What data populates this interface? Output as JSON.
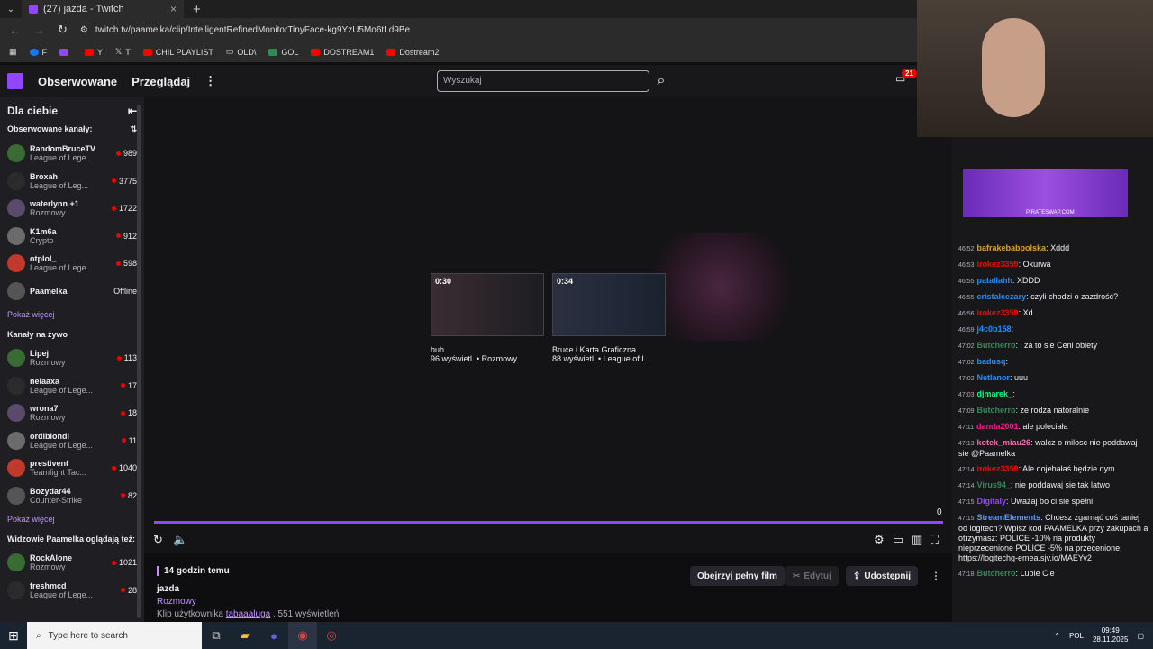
{
  "browser": {
    "tab_title": "(27) jazda - Twitch",
    "url": "twitch.tv/paamelka/clip/IntelligentRefinedMonitorTinyFace-kg9YzU5Mo6tLd9Be",
    "bookmarks": [
      "F",
      "",
      "Y",
      "T",
      "CHIL PLAYLIST",
      "OLD\\",
      "GOL",
      "DOSTREAM1",
      "Dostream2"
    ]
  },
  "nav": {
    "following": "Obserwowane",
    "browse": "Przeglądaj",
    "search_placeholder": "Wyszukaj",
    "notif_count": "21"
  },
  "sidebar": {
    "title": "Dla ciebie",
    "followed_label": "Obserwowane kanały:",
    "followed": [
      {
        "name": "RandomBruceTV",
        "game": "League of Lege...",
        "viewers": "989"
      },
      {
        "name": "Broxah",
        "game": "League of Leg...",
        "viewers": "3775"
      },
      {
        "name": "waterlynn +1",
        "game": "Rozmowy",
        "viewers": "1722"
      },
      {
        "name": "K1m6a",
        "game": "Crypto",
        "viewers": "912"
      },
      {
        "name": "otplol_",
        "game": "League of Lege...",
        "viewers": "598"
      },
      {
        "name": "Paamelka",
        "game": "",
        "viewers": "Offline"
      }
    ],
    "show_more": "Pokaż więcej",
    "live_label": "Kanały na żywo",
    "live": [
      {
        "name": "Lipej",
        "game": "Rozmowy",
        "viewers": "113"
      },
      {
        "name": "nelaaxa",
        "game": "League of Lege...",
        "viewers": "17"
      },
      {
        "name": "wrona7",
        "game": "Rozmowy",
        "viewers": "18"
      },
      {
        "name": "ordiblondi",
        "game": "League of Lege...",
        "viewers": "11"
      },
      {
        "name": "prestivent",
        "game": "Teamfight Tac...",
        "viewers": "1040"
      },
      {
        "name": "Bozydar44",
        "game": "Counter-Strike",
        "viewers": "82"
      }
    ],
    "show_more2": "Pokaż więcej",
    "viewers_also_label": "Widzowie Paamelka oglądają też:",
    "also": [
      {
        "name": "RockAlone",
        "game": "Rozmowy",
        "viewers": "1021"
      },
      {
        "name": "freshmcd",
        "game": "League of Lege...",
        "viewers": "28"
      }
    ]
  },
  "player": {
    "clips": [
      {
        "duration": "0:30",
        "title": "huh",
        "meta": "96 wyświetl. • Rozmowy"
      },
      {
        "duration": "0:34",
        "title": "Bruce i Karta Graficzna",
        "meta": "88 wyświetl. • League of L..."
      }
    ],
    "time": "0",
    "progress": 1.0
  },
  "info": {
    "ago": "14 godzin temu",
    "title": "jazda",
    "category": "Rozmowy",
    "by_prefix": "Klip użytkownika",
    "by_user": "tabaaaluga",
    "views": ". 551 wyświetleń",
    "watch_full": "Obejrzyj pełny film",
    "edit": "Edytuj",
    "share": "Udostępnij"
  },
  "chat": {
    "banner_text": "PIRATESWAP.COM",
    "messages": [
      {
        "t": "46:52",
        "user": "bafrakebabpolska",
        "color": "#daa520",
        "text": ": Xddd"
      },
      {
        "t": "46:53",
        "user": "irokez3359",
        "color": "#ff0000",
        "text": ": Okurwa"
      },
      {
        "t": "46:55",
        "user": "patallahh",
        "color": "#1e90ff",
        "text": ": XDDD"
      },
      {
        "t": "46:55",
        "user": "cristalcezary",
        "color": "#1e90ff",
        "text": ": czyli chodzi o zazdrość?"
      },
      {
        "t": "46:56",
        "user": "irokez3359",
        "color": "#ff0000",
        "text": ": Xd"
      },
      {
        "t": "46:59",
        "user": "j4c0b158",
        "color": "#1e90ff",
        "text": ":"
      },
      {
        "t": "47:02",
        "user": "Butcherro",
        "color": "#2e8b57",
        "text": ": i za to sie Ceni obiety"
      },
      {
        "t": "47:02",
        "user": "badusq",
        "color": "#1e90ff",
        "text": ":"
      },
      {
        "t": "47:02",
        "user": "Netlanor",
        "color": "#1e90ff",
        "text": ": uuu"
      },
      {
        "t": "47:03",
        "user": "djmarek_",
        "color": "#00ff7f",
        "text": ":"
      },
      {
        "t": "47:09",
        "user": "Butcherro",
        "color": "#2e8b57",
        "text": ": ze rodza natoralnie"
      },
      {
        "t": "47:11",
        "user": "danda2001",
        "color": "#ff1493",
        "text": ": ale poleciała"
      },
      {
        "t": "47:13",
        "user": "kotek_miau26",
        "color": "#ff69b4",
        "text": ": walcz o milosc nie poddawaj sie   @Paamelka"
      },
      {
        "t": "47:14",
        "user": "irokez3359",
        "color": "#ff0000",
        "text": ": Ale dojebałaś będzie dym"
      },
      {
        "t": "47:14",
        "user": "Virus94_",
        "color": "#2e8b57",
        "text": ": nie poddawaj sie tak latwo"
      },
      {
        "t": "47:15",
        "user": "Digitaly",
        "color": "#9147ff",
        "text": ": Uważaj bo ci sie spełni"
      },
      {
        "t": "47:15",
        "user": "StreamElements",
        "color": "#5b99ff",
        "text": ": Chcesz zgarnąć coś taniej od logitech? Wpisz kod PAAMELKA przy zakupach a otrzymasz: POLICE -10% na produkty nieprzecenione POLICE -5% na przecenione: https://logitechg-emea.sjv.io/MAEYv2"
      },
      {
        "t": "47:18",
        "user": "Butcherro",
        "color": "#2e8b57",
        "text": ": Lubie Cie"
      }
    ]
  },
  "taskbar": {
    "search_placeholder": "Type here to search",
    "lang": "POL",
    "time": "09:49",
    "date": "28.11.2025"
  }
}
